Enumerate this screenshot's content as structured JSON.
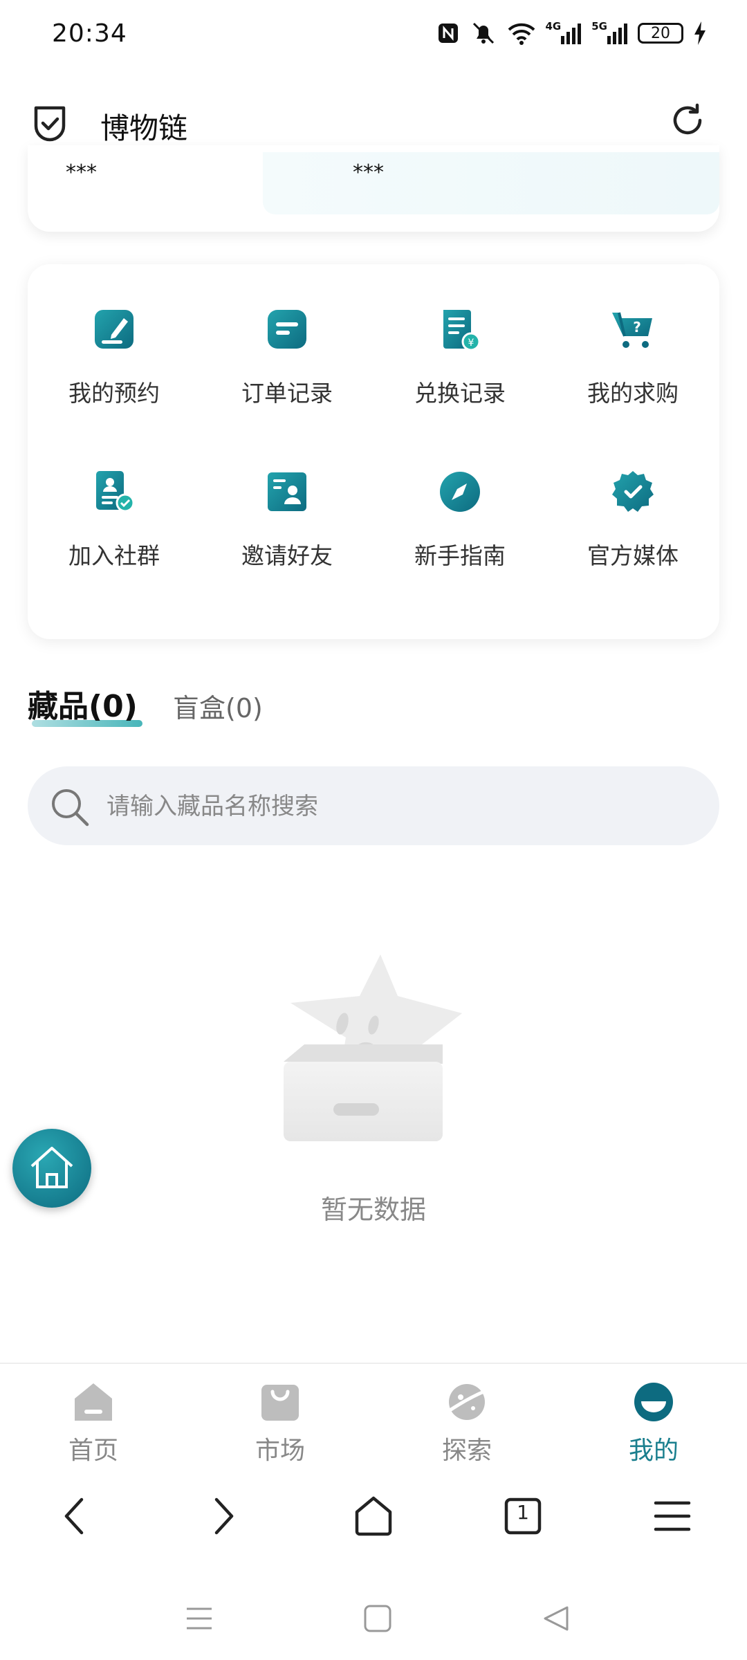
{
  "status": {
    "time": "20:34",
    "net1": "4G",
    "net2": "5G",
    "battery": "20"
  },
  "header": {
    "title": "博物链"
  },
  "top_card": {
    "left_value": "***",
    "right_value": "***"
  },
  "menu": {
    "items": [
      {
        "label": "我的预约",
        "icon": "edit-doc-icon"
      },
      {
        "label": "订单记录",
        "icon": "order-list-icon"
      },
      {
        "label": "兑换记录",
        "icon": "exchange-record-icon"
      },
      {
        "label": "我的求购",
        "icon": "cart-question-icon"
      },
      {
        "label": "加入社群",
        "icon": "community-card-icon"
      },
      {
        "label": "邀请好友",
        "icon": "invite-card-icon"
      },
      {
        "label": "新手指南",
        "icon": "compass-icon"
      },
      {
        "label": "官方媒体",
        "icon": "verified-badge-icon"
      }
    ]
  },
  "tabs": {
    "active": "藏品(0)",
    "inactive": "盲盒(0)"
  },
  "search": {
    "placeholder": "请输入藏品名称搜索"
  },
  "empty": {
    "text": "暂无数据"
  },
  "bottom_nav": {
    "items": [
      {
        "label": "首页",
        "icon": "home-nav-icon"
      },
      {
        "label": "市场",
        "icon": "bag-nav-icon"
      },
      {
        "label": "探索",
        "icon": "planet-nav-icon"
      },
      {
        "label": "我的",
        "icon": "profile-nav-icon"
      }
    ],
    "active_index": 3
  },
  "browser": {
    "tab_count": "1"
  },
  "colors": {
    "accent": "#1a7f8e",
    "icon_dark": "#0d6b80",
    "icon_light": "#23a3ad"
  }
}
